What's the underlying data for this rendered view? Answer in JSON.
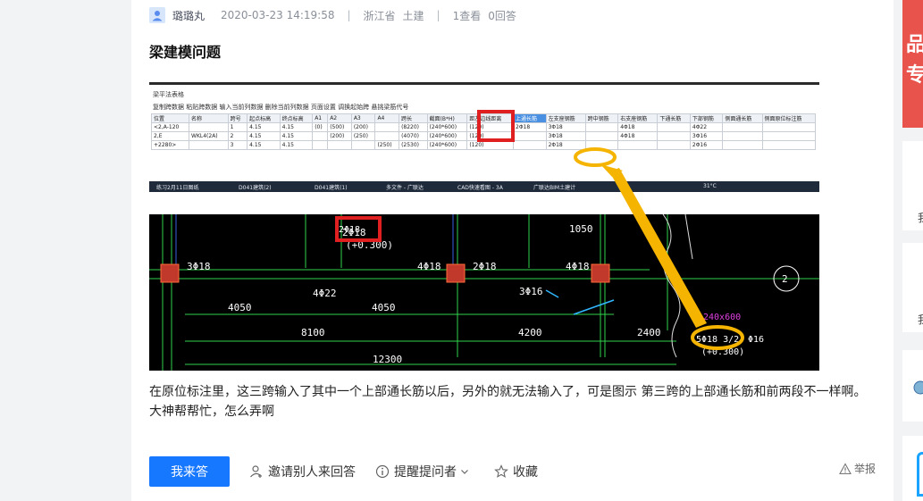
{
  "question": {
    "username": "璐璐丸",
    "datetime": "2020-03-23 14:19:58",
    "separator": "|",
    "location": "浙江省",
    "category": "土建",
    "views": "1查看",
    "answers": "0回答",
    "title": "梁建模问题",
    "body": "在原位标注里，这三跨输入了其中一个上部通长筋以后，另外的就无法输入了，可是图示 第三跨的上部通长筋和前两段不一样啊。大神帮帮忙，怎么弄啊"
  },
  "screenshot": {
    "window_title": "梁平法表格",
    "toolbar": "复制跨数据 粘贴跨数据 输入当前列数据 删除当前列数据 页面设置 调换起始跨 悬挑梁筋代号",
    "headers": [
      "位置",
      "名称",
      "跨号",
      "起点标高",
      "终点标高",
      "A1",
      "A2",
      "A3",
      "A4",
      "跨长",
      "截面(B*H)",
      "距左边线距离",
      "上通长筋",
      "左支座钢筋",
      "跨中钢筋",
      "右支座钢筋",
      "下通长筋",
      "下部钢筋",
      "侧面通长筋",
      "侧面原位标注筋"
    ],
    "rows": [
      [
        "<2,A-120",
        "",
        "1",
        "4.15",
        "4.15",
        "(0)",
        "(500)",
        "(200)",
        "",
        "(8220)",
        "(240*600)",
        "(120)",
        "2Φ18",
        "3Φ18",
        "",
        "4Φ18",
        "",
        "4Φ22",
        "",
        ""
      ],
      [
        "2,E",
        "WKL4(2A)",
        "2",
        "4.15",
        "4.15",
        "",
        "(200)",
        "(250)",
        "",
        "(4070)",
        "(240*600)",
        "(120)",
        "",
        "3Φ18",
        "",
        "4Φ18",
        "",
        "3Φ16",
        "",
        ""
      ],
      [
        "+2280>",
        "",
        "3",
        "4.15",
        "4.15",
        "",
        "",
        "",
        "(250)",
        "(2530)",
        "(240*600)",
        "(120)",
        "",
        "2Φ18",
        "",
        "",
        "",
        "2Φ16",
        "",
        ""
      ]
    ],
    "taskbar": [
      "练习2月11日图纸",
      "D041建筑(2)",
      "D041建筑(1)",
      "多文件 - 广联达",
      "CAD快速看图 - 3A",
      "广联达BIM土建计"
    ],
    "clock": "31°C"
  },
  "cad": {
    "labels": [
      "3Φ18",
      "2Φ18",
      "4Φ18",
      "2Φ18",
      "4Φ18",
      "4Φ22",
      "3Φ16",
      "4050",
      "4050",
      "8100",
      "4200",
      "2400",
      "12300",
      "240x600",
      "5Φ18 3/2",
      "Φ16",
      "(+0.300)",
      "(+0.300)",
      "2Φ18",
      "2",
      "1050"
    ]
  },
  "actions": {
    "answer": "我来答",
    "invite": "邀请别人来回答",
    "remind": "提醒提问者",
    "favorite": "收藏",
    "report": "举报"
  },
  "right_panel": {
    "banner_chars": [
      "品",
      "专"
    ],
    "side_chars": [
      "我",
      "我"
    ]
  },
  "colors": {
    "brand_blue": "#1677ff",
    "highlight_red": "#e02020",
    "annotation_orange": "#f5b400"
  }
}
